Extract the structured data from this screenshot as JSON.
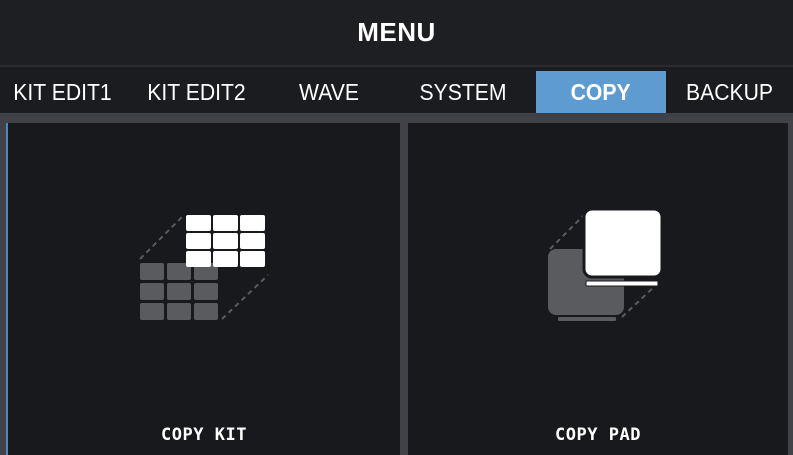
{
  "header": {
    "title": "MENU"
  },
  "tabs": [
    {
      "label": "KIT EDIT1",
      "active": false
    },
    {
      "label": "KIT EDIT2",
      "active": false
    },
    {
      "label": "WAVE",
      "active": false
    },
    {
      "label": "SYSTEM",
      "active": false
    },
    {
      "label": "COPY",
      "active": true
    },
    {
      "label": "BACKUP",
      "active": false
    }
  ],
  "panels": [
    {
      "label": "COPY KIT",
      "icon": "copy-kit-icon"
    },
    {
      "label": "COPY PAD",
      "icon": "copy-pad-icon"
    }
  ],
  "colors": {
    "background": "#1b1c20",
    "active_tab": "#5e9bd0",
    "icon_white": "#ffffff",
    "icon_gray": "#5a5b5e",
    "divider": "#404248"
  }
}
